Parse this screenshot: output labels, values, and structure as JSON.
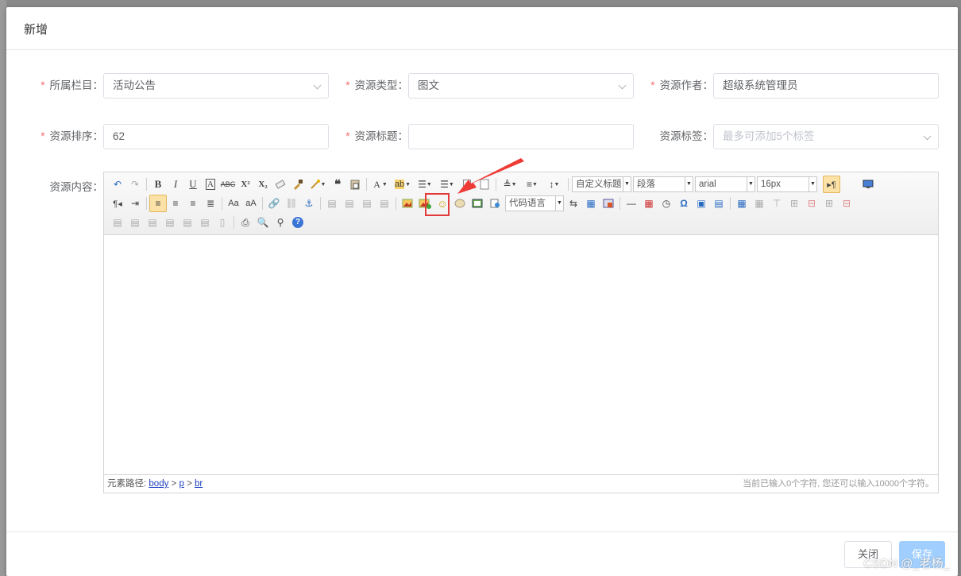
{
  "dialog": {
    "title": "新增"
  },
  "form": {
    "column": {
      "label": "所属栏目",
      "value": "活动公告"
    },
    "type": {
      "label": "资源类型",
      "value": "图文"
    },
    "author": {
      "label": "资源作者",
      "value": "超级系统管理员"
    },
    "order": {
      "label": "资源排序",
      "value": "62"
    },
    "title": {
      "label": "资源标题",
      "value": ""
    },
    "tags": {
      "label": "资源标签",
      "placeholder": "最多可添加5个标签"
    },
    "content": {
      "label": "资源内容"
    },
    "colon": "："
  },
  "toolbar": {
    "combo_heading": "自定义标题",
    "combo_paragraph": "段落",
    "combo_font": "arial",
    "combo_size": "16px",
    "combo_code": "代码语言"
  },
  "status": {
    "path_label": "元素路径:",
    "path": [
      "body",
      "p",
      "br"
    ],
    "sep": ">",
    "count": "当前已输入0个字符, 您还可以输入10000个字符。"
  },
  "footer": {
    "close_label": "关闭",
    "save_label": "保存"
  },
  "watermark": "CSDN @_老杨_",
  "colors": {
    "required": "#f56c6c",
    "annotation": "#e23a3a",
    "primary_disabled": "#a0cfff"
  }
}
